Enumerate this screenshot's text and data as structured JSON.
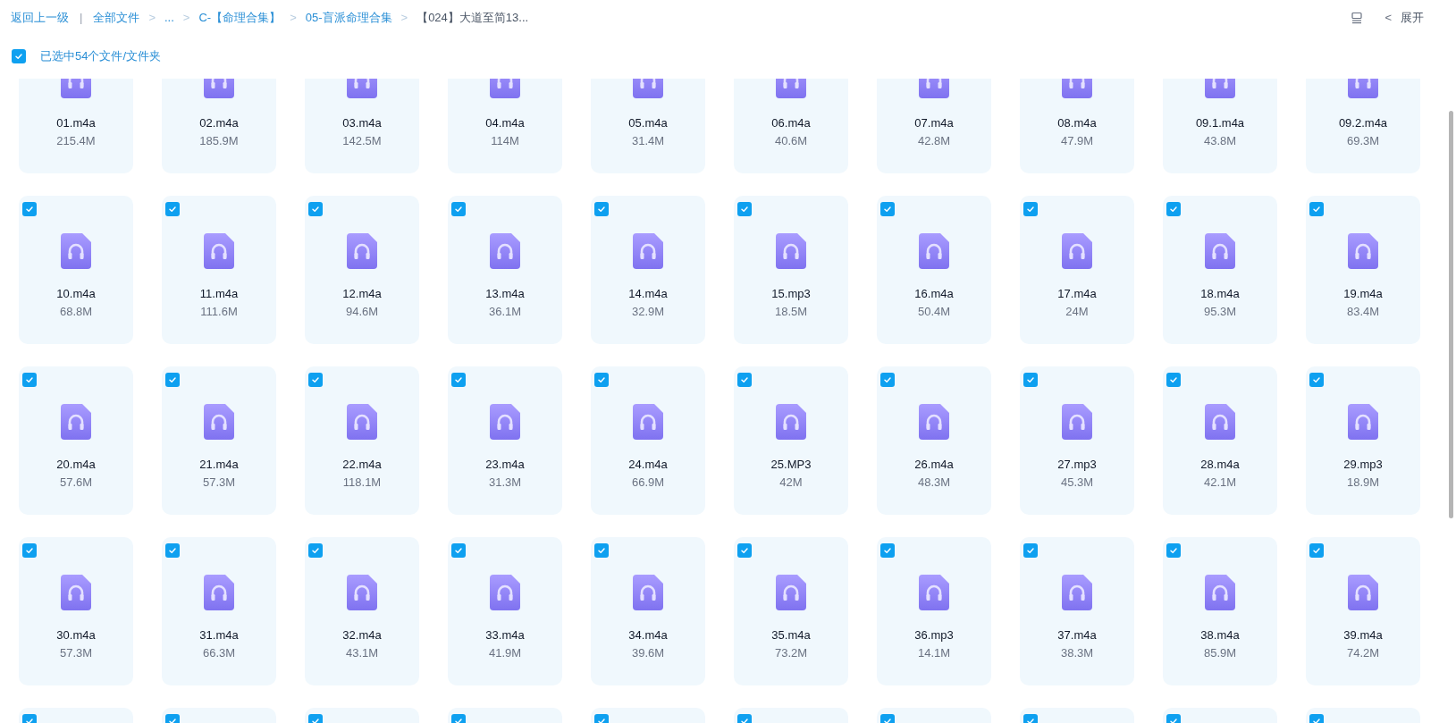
{
  "breadcrumb": {
    "back": "返回上一级",
    "separator": "|",
    "items": [
      {
        "label": "全部文件",
        "current": false
      },
      {
        "label": "...",
        "current": false
      },
      {
        "label": "C-【命理合集】",
        "current": false
      },
      {
        "label": "05-盲派命理合集",
        "current": false
      },
      {
        "label": "【024】大道至简13...",
        "current": true
      }
    ],
    "chevron": ">"
  },
  "toolbar": {
    "expand_label": "展开",
    "expand_arrow": "<"
  },
  "selection": {
    "checked": true,
    "label": "已选中54个文件/文件夹"
  },
  "files": [
    {
      "name": "01.m4a",
      "size": "215.4M"
    },
    {
      "name": "02.m4a",
      "size": "185.9M"
    },
    {
      "name": "03.m4a",
      "size": "142.5M"
    },
    {
      "name": "04.m4a",
      "size": "114M"
    },
    {
      "name": "05.m4a",
      "size": "31.4M"
    },
    {
      "name": "06.m4a",
      "size": "40.6M"
    },
    {
      "name": "07.m4a",
      "size": "42.8M"
    },
    {
      "name": "08.m4a",
      "size": "47.9M"
    },
    {
      "name": "09.1.m4a",
      "size": "43.8M"
    },
    {
      "name": "09.2.m4a",
      "size": "69.3M"
    },
    {
      "name": "10.m4a",
      "size": "68.8M",
      "checked": true
    },
    {
      "name": "11.m4a",
      "size": "111.6M",
      "checked": true
    },
    {
      "name": "12.m4a",
      "size": "94.6M",
      "checked": true
    },
    {
      "name": "13.m4a",
      "size": "36.1M",
      "checked": true
    },
    {
      "name": "14.m4a",
      "size": "32.9M",
      "checked": true
    },
    {
      "name": "15.mp3",
      "size": "18.5M",
      "checked": true
    },
    {
      "name": "16.m4a",
      "size": "50.4M",
      "checked": true
    },
    {
      "name": "17.m4a",
      "size": "24M",
      "checked": true
    },
    {
      "name": "18.m4a",
      "size": "95.3M",
      "checked": true
    },
    {
      "name": "19.m4a",
      "size": "83.4M",
      "checked": true
    },
    {
      "name": "20.m4a",
      "size": "57.6M",
      "checked": true
    },
    {
      "name": "21.m4a",
      "size": "57.3M",
      "checked": true
    },
    {
      "name": "22.m4a",
      "size": "118.1M",
      "checked": true
    },
    {
      "name": "23.m4a",
      "size": "31.3M",
      "checked": true
    },
    {
      "name": "24.m4a",
      "size": "66.9M",
      "checked": true
    },
    {
      "name": "25.MP3",
      "size": "42M",
      "checked": true
    },
    {
      "name": "26.m4a",
      "size": "48.3M",
      "checked": true
    },
    {
      "name": "27.mp3",
      "size": "45.3M",
      "checked": true
    },
    {
      "name": "28.m4a",
      "size": "42.1M",
      "checked": true
    },
    {
      "name": "29.mp3",
      "size": "18.9M",
      "checked": true
    },
    {
      "name": "30.m4a",
      "size": "57.3M",
      "checked": true
    },
    {
      "name": "31.m4a",
      "size": "66.3M",
      "checked": true
    },
    {
      "name": "32.m4a",
      "size": "43.1M",
      "checked": true
    },
    {
      "name": "33.m4a",
      "size": "41.9M",
      "checked": true
    },
    {
      "name": "34.m4a",
      "size": "39.6M",
      "checked": true
    },
    {
      "name": "35.m4a",
      "size": "73.2M",
      "checked": true
    },
    {
      "name": "36.mp3",
      "size": "14.1M",
      "checked": true
    },
    {
      "name": "37.m4a",
      "size": "38.3M",
      "checked": true
    },
    {
      "name": "38.m4a",
      "size": "85.9M",
      "checked": true
    },
    {
      "name": "39.m4a",
      "size": "74.2M",
      "checked": true
    },
    {
      "checked": true
    },
    {
      "checked": true
    },
    {
      "checked": true
    },
    {
      "checked": true
    },
    {
      "checked": true
    },
    {
      "checked": true
    },
    {
      "checked": true
    },
    {
      "checked": true
    },
    {
      "checked": true
    },
    {
      "checked": true
    }
  ]
}
